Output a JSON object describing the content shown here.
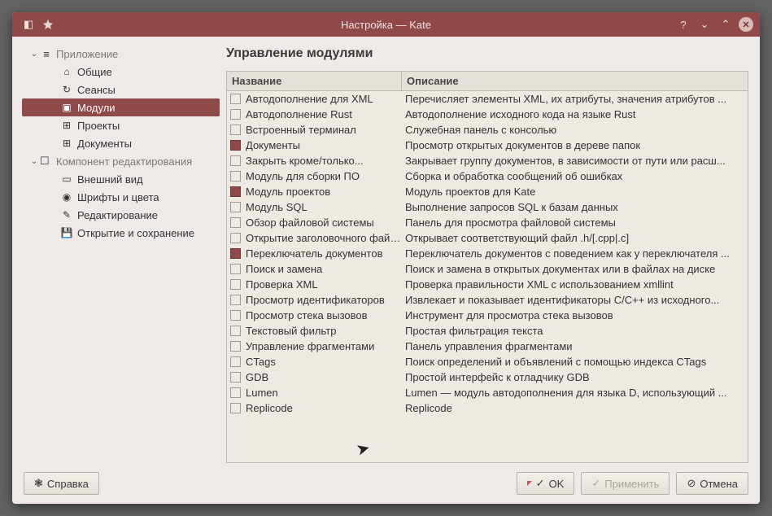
{
  "window": {
    "title": "Настройка — Kate"
  },
  "sidebar": {
    "app_header": "Приложение",
    "editor_header": "Компонент редактирования",
    "items": [
      {
        "label": "Общие"
      },
      {
        "label": "Сеансы"
      },
      {
        "label": "Модули"
      },
      {
        "label": "Проекты"
      },
      {
        "label": "Документы"
      }
    ],
    "editor_items": [
      {
        "label": "Внешний вид"
      },
      {
        "label": "Шрифты и цвета"
      },
      {
        "label": "Редактирование"
      },
      {
        "label": "Открытие и сохранение"
      }
    ]
  },
  "page": {
    "title": "Управление модулями",
    "col_name": "Название",
    "col_desc": "Описание"
  },
  "modules": [
    {
      "checked": false,
      "name": "Автодополнение для XML",
      "desc": "Перечисляет элементы XML, их атрибуты, значения атрибутов ..."
    },
    {
      "checked": false,
      "name": "Автодополнение Rust",
      "desc": "Автодополнение исходного кода на языке Rust"
    },
    {
      "checked": false,
      "name": "Встроенный терминал",
      "desc": "Служебная панель с консолью"
    },
    {
      "checked": true,
      "name": "Документы",
      "desc": "Просмотр открытых документов в дереве папок"
    },
    {
      "checked": false,
      "name": "Закрыть кроме/только...",
      "desc": "Закрывает группу документов, в зависимости от пути или расш..."
    },
    {
      "checked": false,
      "name": "Модуль для сборки ПО",
      "desc": "Сборка и обработка сообщений об ошибках"
    },
    {
      "checked": true,
      "name": "Модуль проектов",
      "desc": "Модуль проектов для Kate"
    },
    {
      "checked": false,
      "name": "Модуль SQL",
      "desc": "Выполнение запросов SQL к базам данных"
    },
    {
      "checked": false,
      "name": "Обзор файловой системы",
      "desc": "Панель для просмотра файловой системы"
    },
    {
      "checked": false,
      "name": "Открытие заголовочного файла",
      "desc": "Открывает соответствующий файл .h/[.cpp|.c]"
    },
    {
      "checked": true,
      "name": "Переключатель документов",
      "desc": "Переключатель документов с поведением как у переключателя ..."
    },
    {
      "checked": false,
      "name": "Поиск и замена",
      "desc": "Поиск и замена в открытых документах или в файлах на диске"
    },
    {
      "checked": false,
      "name": "Проверка XML",
      "desc": "Проверка правильности XML с использованием xmllint"
    },
    {
      "checked": false,
      "name": "Просмотр идентификаторов",
      "desc": "Извлекает и показывает идентификаторы C/C++ из исходного..."
    },
    {
      "checked": false,
      "name": "Просмотр стека вызовов",
      "desc": "Инструмент для просмотра стека вызовов"
    },
    {
      "checked": false,
      "name": "Текстовый фильтр",
      "desc": "Простая фильтрация текста"
    },
    {
      "checked": false,
      "name": "Управление фрагментами",
      "desc": "Панель управления фрагментами"
    },
    {
      "checked": false,
      "name": "CTags",
      "desc": "Поиск определений и объявлений с помощью индекса CTags"
    },
    {
      "checked": false,
      "name": "GDB",
      "desc": "Простой интерфейс к отладчику GDB"
    },
    {
      "checked": false,
      "name": "Lumen",
      "desc": "Lumen — модуль автодополнения для языка D, использующий ..."
    },
    {
      "checked": false,
      "name": "Replicode",
      "desc": "Replicode"
    }
  ],
  "footer": {
    "help": "Справка",
    "ok": "OK",
    "apply": "Применить",
    "cancel": "Отмена"
  }
}
